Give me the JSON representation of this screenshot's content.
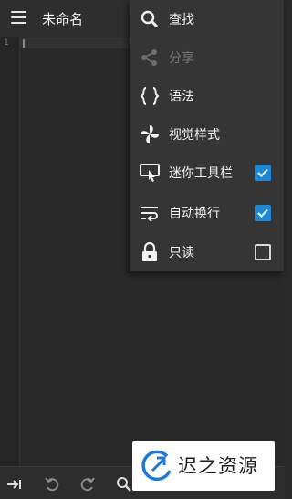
{
  "app": {
    "title": "未命名"
  },
  "editor": {
    "line_numbers": [
      "1"
    ]
  },
  "menu": {
    "items": [
      {
        "label": "查找",
        "icon": "search-icon",
        "enabled": true
      },
      {
        "label": "分享",
        "icon": "share-icon",
        "enabled": false
      },
      {
        "label": "语法",
        "icon": "braces-icon",
        "enabled": true
      },
      {
        "label": "视觉样式",
        "icon": "pinwheel-icon",
        "enabled": true
      },
      {
        "label": "迷你工具栏",
        "icon": "toolbar-touch-icon",
        "enabled": true,
        "checked": true
      },
      {
        "label": "自动换行",
        "icon": "word-wrap-icon",
        "enabled": true,
        "checked": true
      },
      {
        "label": "只读",
        "icon": "lock-icon",
        "enabled": true,
        "checked": false
      }
    ]
  },
  "toolbar": {
    "icons": [
      "tab-indent-icon",
      "undo-icon",
      "redo-icon",
      "search-icon"
    ]
  },
  "watermark": {
    "text": "迟之资源"
  },
  "colors": {
    "background": "#2b2b2b",
    "menu": "#353535",
    "accent": "#1e88d6"
  }
}
